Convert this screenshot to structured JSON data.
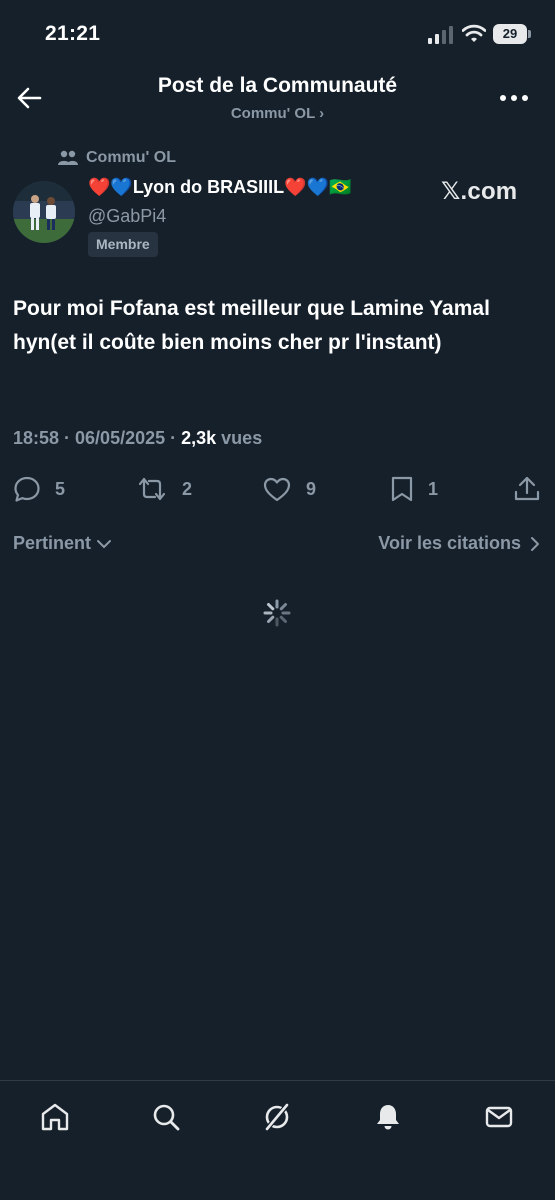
{
  "status": {
    "time": "21:21",
    "battery": "29"
  },
  "header": {
    "title": "Post de la Communauté",
    "subtitle": "Commu' OL ›"
  },
  "community": {
    "label": "Commu' OL"
  },
  "author": {
    "display_name": "❤️💙Lyon do BRASIIIL❤️💙🇧🇷",
    "handle": "@GabPi4",
    "badge": "Membre",
    "source": "𝕏.com"
  },
  "post": {
    "text": "Pour moi Fofana est meilleur que Lamine Yamal hyn(et il coûte bien moins cher pr l'instant)",
    "timestamp": "18:58 · 06/05/2025 · ",
    "views_count": "2,3k",
    "views_label": " vues"
  },
  "actions": {
    "replies": "5",
    "reposts": "2",
    "likes": "9",
    "bookmarks": "1"
  },
  "sort": {
    "left_label": "Pertinent",
    "right_label": "Voir les citations"
  },
  "nav": {
    "items": [
      "home-icon",
      "search-icon",
      "grok-icon",
      "notifications-icon",
      "messages-icon"
    ]
  },
  "colors": {
    "background": "#15202b",
    "secondary_text": "#8b98a5",
    "badge_bg": "#273340"
  }
}
